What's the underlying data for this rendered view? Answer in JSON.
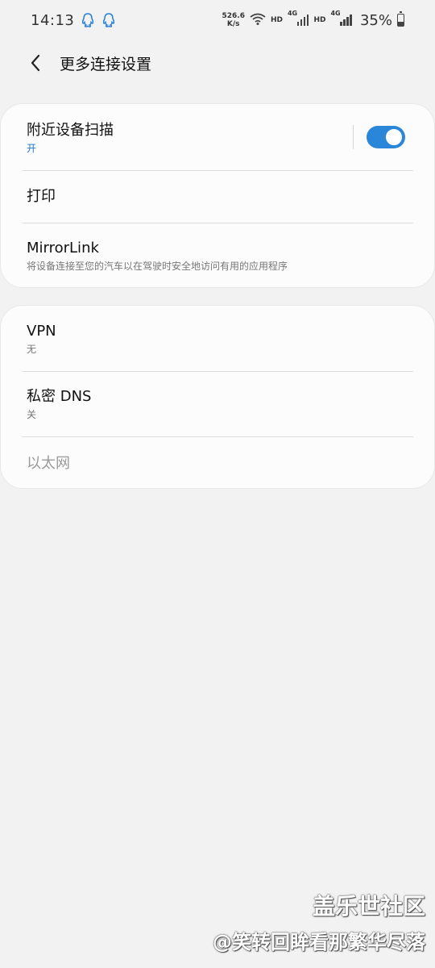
{
  "status_bar": {
    "time": "14:13",
    "net_speed_value": "526.6",
    "net_speed_unit": "K/s",
    "hd1": "HD",
    "net1": "4G",
    "hd2": "HD",
    "net2": "4G",
    "battery": "35%",
    "battery_level": 0.35,
    "icons": [
      "qq-icon",
      "qq-icon",
      "wifi-icon",
      "signal-icon",
      "signal-icon",
      "battery-icon"
    ]
  },
  "app_bar": {
    "back_icon": "chevron-left-icon",
    "title": "更多连接设置"
  },
  "section1": {
    "nearby": {
      "title": "附近设备扫描",
      "status": "开",
      "toggle_on": true
    },
    "print": {
      "title": "打印"
    },
    "mirrorlink": {
      "title": "MirrorLink",
      "desc": "将设备连接至您的汽车以在驾驶时安全地访问有用的应用程序"
    }
  },
  "section2": {
    "vpn": {
      "title": "VPN",
      "status": "无"
    },
    "private_dns": {
      "title": "私密 DNS",
      "status": "关"
    },
    "ethernet": {
      "title": "以太网"
    }
  },
  "watermark": {
    "line1": "盖乐世社区",
    "line2": "@笑转回眸看那繁华尽落"
  },
  "colors": {
    "accent": "#2a86d8",
    "background": "#f2f2f2",
    "card": "#fcfcfc"
  }
}
